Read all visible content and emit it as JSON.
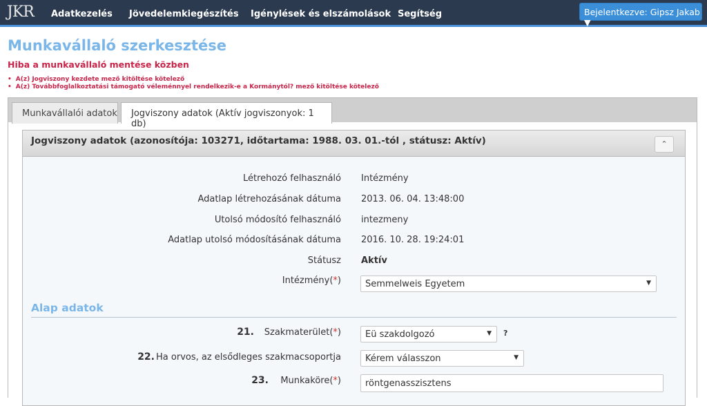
{
  "navbar": {
    "logo": "JKR",
    "items": [
      "Adatkezelés",
      "Jövedelemkiegészítés",
      "Igénylések és elszámolások",
      "Segítség"
    ],
    "login": "Bejelentkezve: Gipsz Jakab ▼"
  },
  "page": {
    "title": "Munkavállaló szerkesztése",
    "error_title": "Hiba a munkavállaló mentése közben",
    "errors": [
      "A(z) Jogviszony kezdete mező kitöltése kötelező",
      "A(z) Továbbfoglalkoztatási támogató véleménnyel rendelkezik-e a Kormánytól? mező kitöltése kötelező"
    ]
  },
  "tabs": [
    "Munkavállalói adatok",
    "Jogviszony adatok (Aktív jogviszonyok: 1 db)"
  ],
  "panel": {
    "title": "Jogviszony adatok (azonosítója: 103271, időtartama: 1988. 03. 01.-tól , státusz: Aktív)",
    "collapse": "⌃",
    "rows": [
      {
        "label": "Létrehozó felhasználó",
        "value": "Intézmény"
      },
      {
        "label": "Adatlap létrehozásának dátuma",
        "value": "2013. 06. 04. 13:48:00"
      },
      {
        "label": "Utolsó módosító felhasználó",
        "value": "intezmeny"
      },
      {
        "label": "Adatlap utolsó módosításának dátuma",
        "value": "2016. 10. 28. 19:24:01"
      },
      {
        "label": "Státusz",
        "value": "Aktív"
      }
    ],
    "institution_label": "Intézmény(",
    "required_mark": "*",
    "label_close": ")",
    "institution_value": "Semmelweis Egyetem"
  },
  "alap": {
    "title": "Alap adatok",
    "fields": [
      {
        "num": "21.",
        "label": "Szakmaterület(",
        "value": "Eü szakdolgozó",
        "help": "?"
      },
      {
        "num": "22.",
        "label": "Ha orvos, az elsődleges szakmacsoportja",
        "value": "Kérem válasszon"
      },
      {
        "num": "23.",
        "label": "Munkaköre(",
        "value": "röntgenasszisztens"
      }
    ]
  }
}
